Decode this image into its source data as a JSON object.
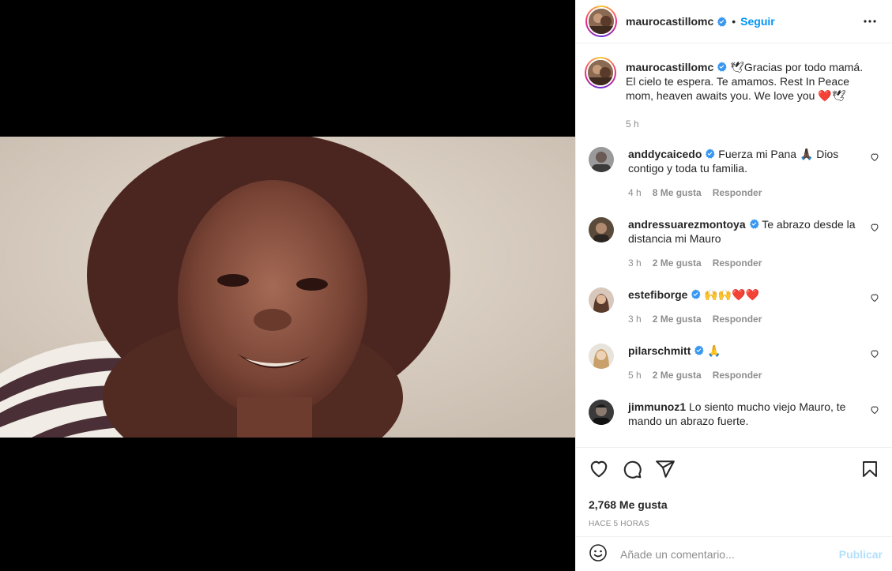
{
  "header": {
    "username": "maurocastillomc",
    "separator": "•",
    "follow_label": "Seguir"
  },
  "caption": {
    "username": "maurocastillomc",
    "text": "🕊Gracias por todo mamá. El cielo te espera. Te amamos. Rest In Peace mom, heaven awaits you. We love you ❤️🕊",
    "time": "5 h"
  },
  "comments": [
    {
      "username": "anddycaicedo",
      "verified": true,
      "text": "Fuerza mi Pana 🙏🏿 Dios contigo y toda tu familia.",
      "time": "4 h",
      "likes": "8 Me gusta",
      "reply": "Responder"
    },
    {
      "username": "andressuarezmontoya",
      "verified": true,
      "text": "Te abrazo desde la distancia mi Mauro",
      "time": "3 h",
      "likes": "2 Me gusta",
      "reply": "Responder"
    },
    {
      "username": "estefiborge",
      "verified": true,
      "text": "🙌🙌❤️❤️",
      "time": "3 h",
      "likes": "2 Me gusta",
      "reply": "Responder"
    },
    {
      "username": "pilarschmitt",
      "verified": true,
      "text": "🙏",
      "time": "5 h",
      "likes": "2 Me gusta",
      "reply": "Responder"
    },
    {
      "username": "jimmunoz1",
      "verified": false,
      "text": "Lo siento mucho viejo Mauro, te mando un abrazo fuerte.",
      "time": "",
      "likes": "",
      "reply": ""
    }
  ],
  "stats": {
    "likes": "2,768 Me gusta",
    "posted": "HACE 5 HORAS"
  },
  "add_comment": {
    "placeholder": "Añade un comentario...",
    "post_label": "Publicar"
  },
  "colors": {
    "accent": "#0095f6",
    "post_disabled": "#b2dffc",
    "muted": "#8e8e8e",
    "heart_red": "#ed4956"
  },
  "icons": [
    "more-icon",
    "verified-icon",
    "heart-icon",
    "comment-icon",
    "share-icon",
    "bookmark-icon",
    "emoji-icon"
  ]
}
